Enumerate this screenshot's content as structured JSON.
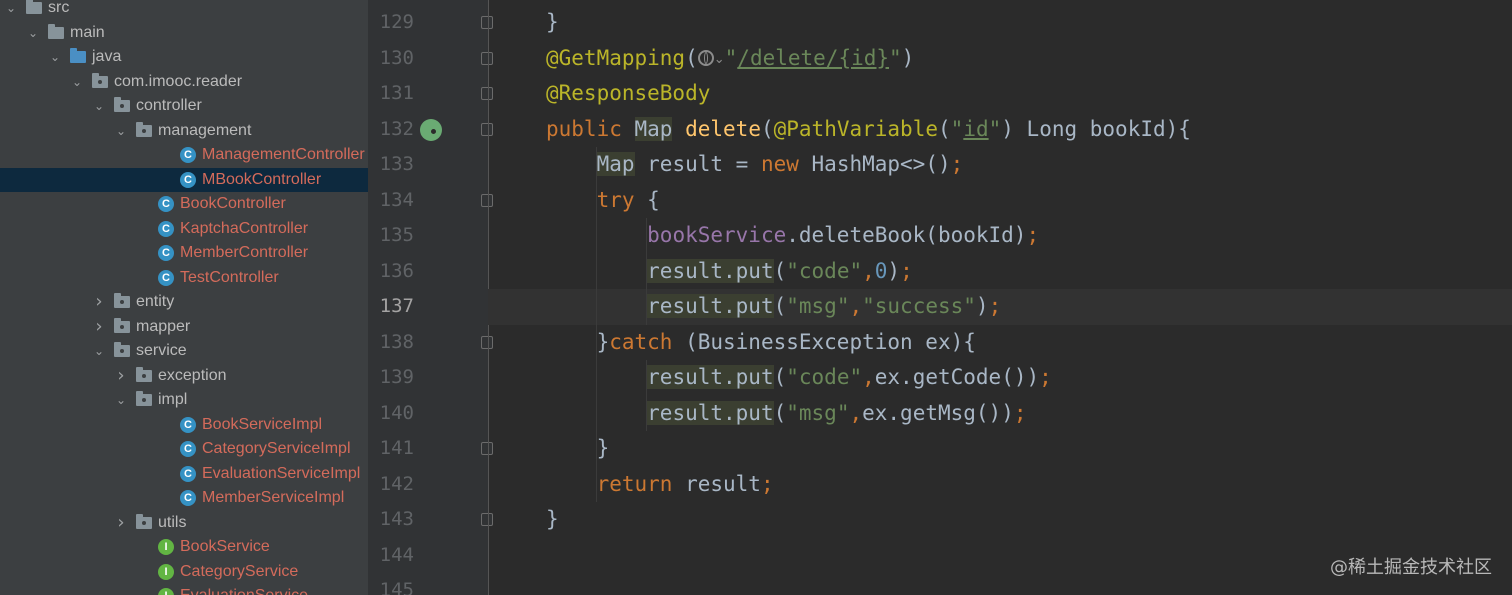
{
  "project_tree": {
    "items": [
      {
        "label": "src",
        "kind": "folder",
        "icon": "folder-icon",
        "expanded": true
      },
      {
        "label": "main",
        "kind": "folder",
        "icon": "folder-icon",
        "expanded": true
      },
      {
        "label": "java",
        "kind": "source-root",
        "icon": "source-folder-icon",
        "expanded": true
      },
      {
        "label": "com.imooc.reader",
        "kind": "package",
        "icon": "package-icon",
        "expanded": true
      },
      {
        "label": "controller",
        "kind": "package",
        "icon": "package-icon",
        "expanded": true
      },
      {
        "label": "management",
        "kind": "package",
        "icon": "package-icon",
        "expanded": true
      },
      {
        "label": "ManagementController",
        "kind": "class",
        "icon": "class-icon",
        "icon_letter": "C"
      },
      {
        "label": "MBookController",
        "kind": "class",
        "icon": "class-icon",
        "icon_letter": "C",
        "selected": true
      },
      {
        "label": "BookController",
        "kind": "class",
        "icon": "class-icon",
        "icon_letter": "C"
      },
      {
        "label": "KaptchaController",
        "kind": "class",
        "icon": "class-icon",
        "icon_letter": "C"
      },
      {
        "label": "MemberController",
        "kind": "class",
        "icon": "class-icon",
        "icon_letter": "C"
      },
      {
        "label": "TestController",
        "kind": "class",
        "icon": "class-icon",
        "icon_letter": "C"
      },
      {
        "label": "entity",
        "kind": "package",
        "icon": "package-icon",
        "expanded": false
      },
      {
        "label": "mapper",
        "kind": "package",
        "icon": "package-icon",
        "expanded": false
      },
      {
        "label": "service",
        "kind": "package",
        "icon": "package-icon",
        "expanded": true
      },
      {
        "label": "exception",
        "kind": "package",
        "icon": "package-icon",
        "expanded": false
      },
      {
        "label": "impl",
        "kind": "package",
        "icon": "package-icon",
        "expanded": true
      },
      {
        "label": "BookServiceImpl",
        "kind": "class",
        "icon": "class-icon",
        "icon_letter": "C"
      },
      {
        "label": "CategoryServiceImpl",
        "kind": "class",
        "icon": "class-icon",
        "icon_letter": "C"
      },
      {
        "label": "EvaluationServiceImpl",
        "kind": "class",
        "icon": "class-icon",
        "icon_letter": "C"
      },
      {
        "label": "MemberServiceImpl",
        "kind": "class",
        "icon": "class-icon",
        "icon_letter": "C"
      },
      {
        "label": "utils",
        "kind": "package",
        "icon": "package-icon",
        "expanded": false
      },
      {
        "label": "BookService",
        "kind": "interface",
        "icon": "interface-icon",
        "icon_letter": "I"
      },
      {
        "label": "CategoryService",
        "kind": "interface",
        "icon": "interface-icon",
        "icon_letter": "I"
      },
      {
        "label": "EvaluationService",
        "kind": "interface",
        "icon": "interface-icon",
        "icon_letter": "I"
      }
    ]
  },
  "editor": {
    "current_line": 137,
    "lines": [
      {
        "number": 129,
        "tokens": [
          [
            "}",
            ""
          ]
        ]
      },
      {
        "number": 130,
        "tokens": [
          [
            "@GetMapping",
            "a"
          ],
          [
            "(",
            ""
          ],
          [
            "GLOBE",
            "icon"
          ],
          [
            "\"",
            "s"
          ],
          [
            "/delete/{id}",
            "s link"
          ],
          [
            "\"",
            "s"
          ],
          [
            ")",
            ""
          ]
        ]
      },
      {
        "number": 131,
        "tokens": [
          [
            "@ResponseBody",
            "a"
          ]
        ]
      },
      {
        "number": 132,
        "tokens": [
          [
            "public ",
            "k"
          ],
          [
            "Map",
            "hl"
          ],
          [
            " ",
            ""
          ],
          [
            "delete",
            "f"
          ],
          [
            "(",
            ""
          ],
          [
            "@PathVariable",
            "a"
          ],
          [
            "(",
            ""
          ],
          [
            "\"",
            "s"
          ],
          [
            "id",
            "s link"
          ],
          [
            "\"",
            "s"
          ],
          [
            ") Long bookId){",
            ""
          ]
        ]
      },
      {
        "number": 133,
        "tokens": [
          [
            "    ",
            ""
          ],
          [
            "Map",
            "hl"
          ],
          [
            " result = ",
            ""
          ],
          [
            "new ",
            "k"
          ],
          [
            "HashMap<>()",
            ""
          ],
          [
            ";",
            "k"
          ]
        ]
      },
      {
        "number": 134,
        "tokens": [
          [
            "    ",
            ""
          ],
          [
            "try ",
            "k"
          ],
          [
            "{",
            ""
          ]
        ]
      },
      {
        "number": 135,
        "tokens": [
          [
            "        ",
            ""
          ],
          [
            "bookService",
            "fld"
          ],
          [
            ".deleteBook(bookId)",
            ""
          ],
          [
            ";",
            "k"
          ]
        ]
      },
      {
        "number": 136,
        "tokens": [
          [
            "        ",
            ""
          ],
          [
            "result.put",
            "hl"
          ],
          [
            "(",
            ""
          ],
          [
            "\"code\"",
            "s"
          ],
          [
            ",",
            "k"
          ],
          [
            "0",
            "n"
          ],
          [
            ")",
            ""
          ],
          [
            ";",
            "k"
          ]
        ]
      },
      {
        "number": 137,
        "tokens": [
          [
            "        ",
            ""
          ],
          [
            "result.put",
            "hl"
          ],
          [
            "(",
            ""
          ],
          [
            "\"msg\"",
            "s"
          ],
          [
            ",",
            "k"
          ],
          [
            "\"success\"",
            "s"
          ],
          [
            ")",
            ""
          ],
          [
            ";",
            "k"
          ]
        ]
      },
      {
        "number": 138,
        "tokens": [
          [
            "    ",
            ""
          ],
          [
            "}",
            ""
          ],
          [
            "catch ",
            "k"
          ],
          [
            "(BusinessException ex){",
            ""
          ]
        ]
      },
      {
        "number": 139,
        "tokens": [
          [
            "        ",
            ""
          ],
          [
            "result.put",
            "hl"
          ],
          [
            "(",
            ""
          ],
          [
            "\"code\"",
            "s"
          ],
          [
            ",",
            "k"
          ],
          [
            "ex.getCode())",
            ""
          ],
          [
            ";",
            "k"
          ]
        ]
      },
      {
        "number": 140,
        "tokens": [
          [
            "        ",
            ""
          ],
          [
            "result.put",
            "hl"
          ],
          [
            "(",
            ""
          ],
          [
            "\"msg\"",
            "s"
          ],
          [
            ",",
            "k"
          ],
          [
            "ex.getMsg())",
            ""
          ],
          [
            ";",
            "k"
          ]
        ]
      },
      {
        "number": 141,
        "tokens": [
          [
            "    ",
            ""
          ],
          [
            "}",
            ""
          ]
        ]
      },
      {
        "number": 142,
        "tokens": [
          [
            "    ",
            ""
          ],
          [
            "return ",
            "k"
          ],
          [
            "result",
            ""
          ],
          [
            ";",
            "k"
          ]
        ]
      },
      {
        "number": 143,
        "tokens": [
          [
            "}",
            ""
          ]
        ]
      },
      {
        "number": 144,
        "tokens": []
      },
      {
        "number": 145,
        "tokens": []
      }
    ],
    "fold_lines": [
      129,
      130,
      131,
      132,
      134,
      138,
      141,
      143
    ],
    "gutter_icons": [
      {
        "line": 132,
        "icon": "spring-bean-icon"
      }
    ]
  },
  "watermark": "@稀土掘金技术社区",
  "colors": {
    "keyword": "#cc7832",
    "annotation": "#bbb529",
    "string": "#6a8759",
    "number": "#6897bb",
    "method": "#ffc66d",
    "field": "#9876aa",
    "class_label": "#d46b5b",
    "selection": "#0d293e"
  }
}
